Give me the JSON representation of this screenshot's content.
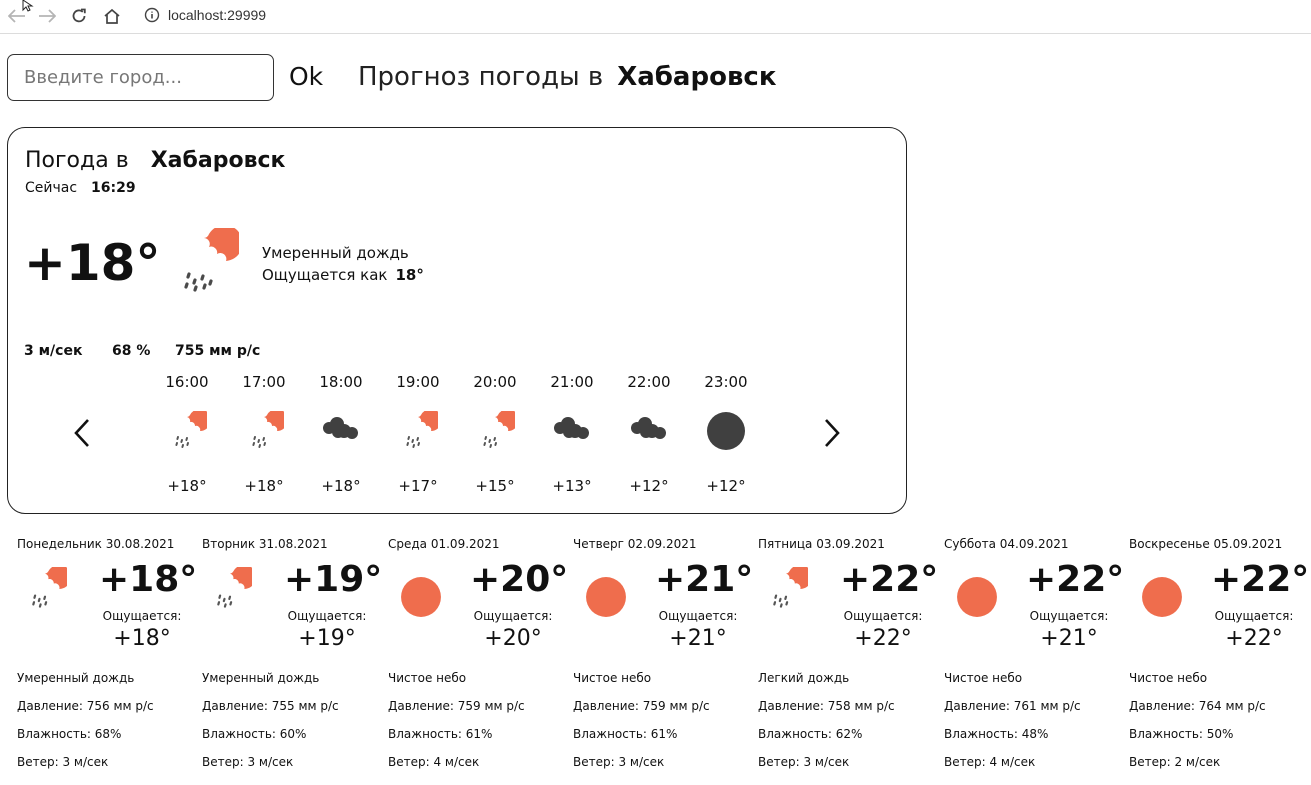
{
  "browser": {
    "url": "localhost:29999",
    "back_icon": "arrow-left-icon",
    "forward_icon": "arrow-right-icon",
    "reload_icon": "reload-icon",
    "home_icon": "home-icon",
    "info_icon": "info-icon"
  },
  "search": {
    "placeholder": "Введите город...",
    "ok_label": "Ok"
  },
  "header": {
    "prefix": "Прогноз погоды в",
    "city": "Хабаровск"
  },
  "current": {
    "title_prefix": "Погода в",
    "city": "Хабаровск",
    "now_label": "Сейчас",
    "time": "16:29",
    "temp": "+18°",
    "icon": "rain-icon",
    "condition": "Умеренный дождь",
    "feels_label": "Ощущается как",
    "feels_value": "18°",
    "wind": "3 м/сек",
    "humidity": "68 %",
    "pressure": "755 мм р/с"
  },
  "hourly": [
    {
      "time": "16:00",
      "icon": "rain-icon",
      "temp": "+18°"
    },
    {
      "time": "17:00",
      "icon": "rain-icon",
      "temp": "+18°"
    },
    {
      "time": "18:00",
      "icon": "cloud-icon",
      "temp": "+18°"
    },
    {
      "time": "19:00",
      "icon": "rain-icon",
      "temp": "+17°"
    },
    {
      "time": "20:00",
      "icon": "rain-icon",
      "temp": "+15°"
    },
    {
      "time": "21:00",
      "icon": "cloud-icon",
      "temp": "+13°"
    },
    {
      "time": "22:00",
      "icon": "cloud-icon",
      "temp": "+12°"
    },
    {
      "time": "23:00",
      "icon": "moon-icon",
      "temp": "+12°"
    }
  ],
  "daily": [
    {
      "name": "Понедельник 30.08.2021",
      "icon": "rain-icon",
      "temp": "+18°",
      "feels_label": "Ощущается:",
      "feels": "+18°",
      "condition": "Умеренный дождь",
      "pressure": "Давление: 756 мм р/с",
      "humidity": "Влажность: 68%",
      "wind": "Ветер: 3 м/сек"
    },
    {
      "name": "Вторник 31.08.2021",
      "icon": "rain-icon",
      "temp": "+19°",
      "feels_label": "Ощущается:",
      "feels": "+19°",
      "condition": "Умеренный дождь",
      "pressure": "Давление: 755 мм р/с",
      "humidity": "Влажность: 60%",
      "wind": "Ветер: 3 м/сек"
    },
    {
      "name": "Среда 01.09.2021",
      "icon": "sun-icon",
      "temp": "+20°",
      "feels_label": "Ощущается:",
      "feels": "+20°",
      "condition": "Чистое небо",
      "pressure": "Давление: 759 мм р/с",
      "humidity": "Влажность: 61%",
      "wind": "Ветер: 4 м/сек"
    },
    {
      "name": "Четверг 02.09.2021",
      "icon": "sun-icon",
      "temp": "+21°",
      "feels_label": "Ощущается:",
      "feels": "+21°",
      "condition": "Чистое небо",
      "pressure": "Давление: 759 мм р/с",
      "humidity": "Влажность: 61%",
      "wind": "Ветер: 3 м/сек"
    },
    {
      "name": "Пятница 03.09.2021",
      "icon": "rain-icon",
      "temp": "+22°",
      "feels_label": "Ощущается:",
      "feels": "+22°",
      "condition": "Легкий дождь",
      "pressure": "Давление: 758 мм р/с",
      "humidity": "Влажность: 62%",
      "wind": "Ветер: 3 м/сек"
    },
    {
      "name": "Суббота 04.09.2021",
      "icon": "sun-icon",
      "temp": "+22°",
      "feels_label": "Ощущается:",
      "feels": "+21°",
      "condition": "Чистое небо",
      "pressure": "Давление: 761 мм р/с",
      "humidity": "Влажность: 48%",
      "wind": "Ветер: 4 м/сек"
    },
    {
      "name": "Воскресенье 05.09.2021",
      "icon": "sun-icon",
      "temp": "+22°",
      "feels_label": "Ощущается:",
      "feels": "+22°",
      "condition": "Чистое небо",
      "pressure": "Давление: 764 мм р/с",
      "humidity": "Влажность: 50%",
      "wind": "Ветер: 2 м/сек"
    }
  ],
  "colors": {
    "accent": "#ef6d4d",
    "dark_icon": "#404040",
    "text": "#111111"
  }
}
